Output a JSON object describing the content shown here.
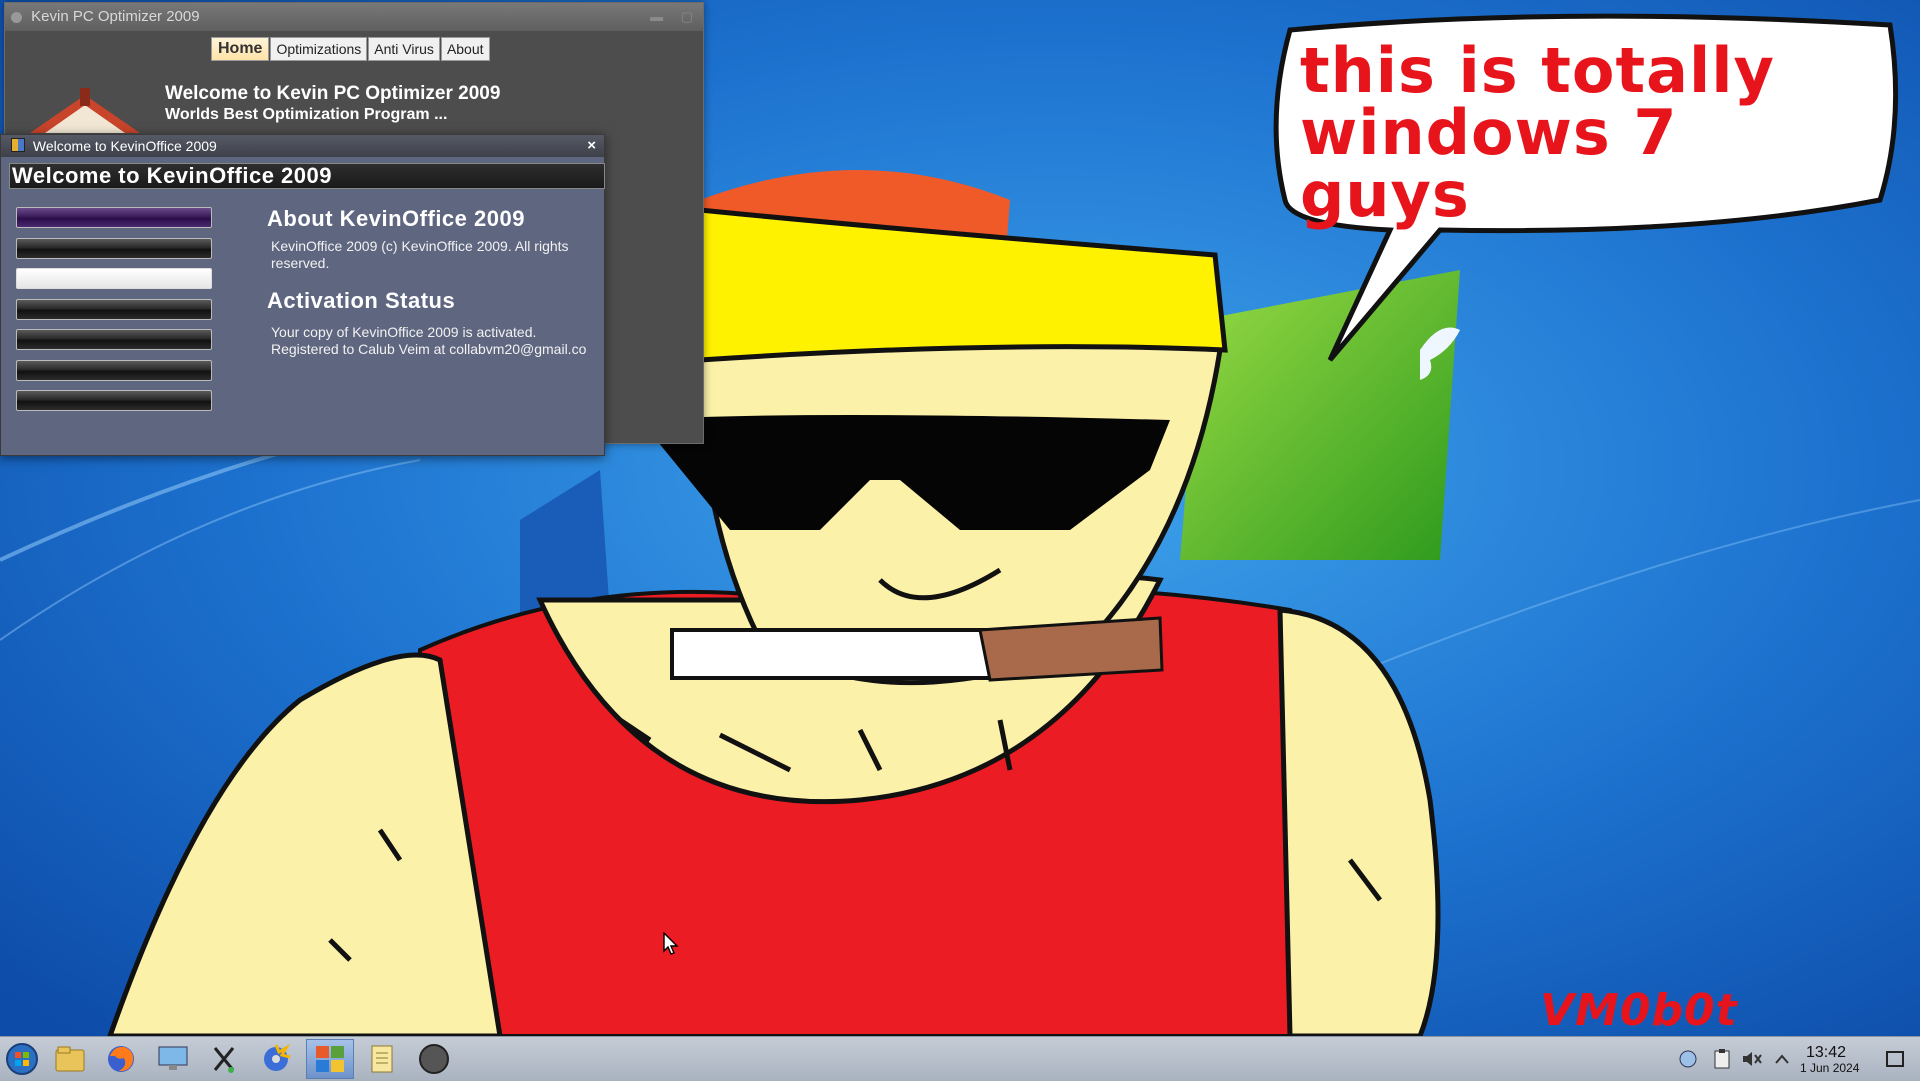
{
  "desktop": {
    "bubble_text": "this is totally windows 7 guys",
    "watermark": "VM0b0t"
  },
  "optimizer_window": {
    "title": "Kevin PC Optimizer 2009",
    "tabs": [
      {
        "label": "Home",
        "active": true
      },
      {
        "label": "Optimizations",
        "active": false
      },
      {
        "label": "Anti Virus",
        "active": false
      },
      {
        "label": "About",
        "active": false
      }
    ],
    "welcome_title": "Welcome to Kevin PC Optimizer 2009",
    "welcome_subtitle": "Worlds Best Optimization Program ..."
  },
  "office_window": {
    "title": "Welcome to KevinOffice 2009",
    "close_label": "×",
    "header": "Welcome to KevinOffice 2009",
    "about_heading": "About KevinOffice 2009",
    "about_text": "KevinOffice 2009 (c) KevinOffice 2009. All rights reserved.",
    "activation_heading": "Activation Status",
    "activation_line1": "Your copy of KevinOffice 2009 is activated.",
    "activation_line2": "Registered to Calub Veim at collabvm20@gmail.co"
  },
  "taskbar": {
    "icons": [
      "start-orb-icon",
      "file-manager-icon",
      "firefox-icon",
      "remote-desktop-icon",
      "tool-x-icon",
      "burning-disc-icon",
      "kevin-office-icon",
      "notepad-icon",
      "safari-compass-icon"
    ],
    "clock_time": "13:42",
    "clock_date": "1 Jun 2024"
  }
}
